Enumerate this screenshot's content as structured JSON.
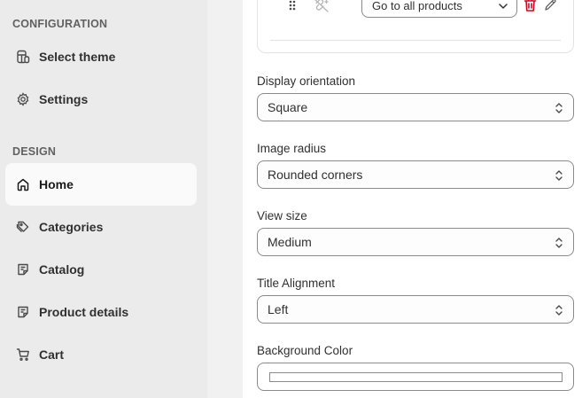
{
  "sidebar": {
    "sections": [
      {
        "label": "CONFIGURATION",
        "items": [
          {
            "label": "Select theme",
            "icon": "theme-icon"
          },
          {
            "label": "Settings",
            "icon": "gear-icon"
          }
        ]
      },
      {
        "label": "DESIGN",
        "items": [
          {
            "label": "Home",
            "icon": "home-icon",
            "active": true
          },
          {
            "label": "Categories",
            "icon": "tag-icon"
          },
          {
            "label": "Catalog",
            "icon": "catalog-icon"
          },
          {
            "label": "Product details",
            "icon": "product-details-icon"
          },
          {
            "label": "Cart",
            "icon": "cart-icon"
          }
        ]
      }
    ]
  },
  "link_row": {
    "action_value": "Go to all products"
  },
  "fields": [
    {
      "label": "Display orientation",
      "value": "Square"
    },
    {
      "label": "Image radius",
      "value": "Rounded corners"
    },
    {
      "label": "View size",
      "value": "Medium"
    },
    {
      "label": "Title Alignment",
      "value": "Left"
    }
  ],
  "background_color": {
    "label": "Background Color",
    "value": "#ffffff"
  },
  "colors": {
    "sidebar_bg": "#ebebeb",
    "active_item_bg": "#fafafa",
    "delete_red": "#c70a24",
    "border": "#8a8a8a"
  }
}
